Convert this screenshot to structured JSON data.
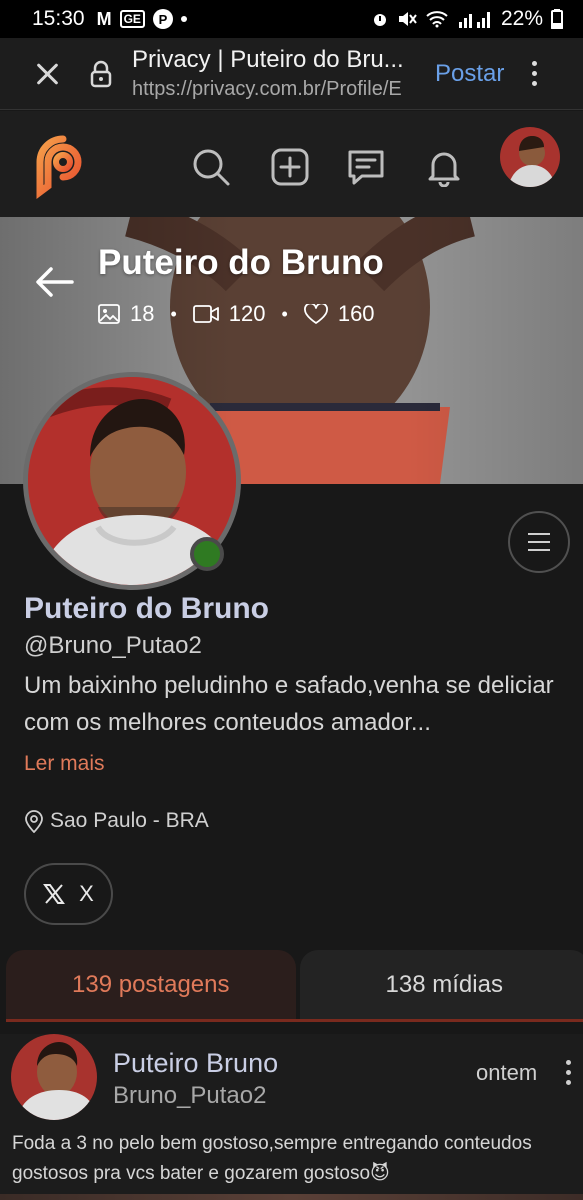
{
  "status_bar": {
    "time": "15:30",
    "battery": "22%",
    "icons": [
      "gmail-icon",
      "news-icon",
      "p-app-icon",
      "dot-icon",
      "alarm-icon",
      "mute-icon",
      "wifi-icon",
      "signal-icon",
      "battery-icon"
    ]
  },
  "browser": {
    "title": "Privacy | Puteiro do Bru...",
    "url": "https://privacy.com.br/Profile/E",
    "action_label": "Postar"
  },
  "header": {
    "icons": [
      "privacy-logo-icon",
      "search-icon",
      "add-post-icon",
      "messages-icon",
      "bell-icon",
      "user-avatar"
    ]
  },
  "cover": {
    "title": "Puteiro do Bruno",
    "photos_count": "18",
    "videos_count": "120",
    "likes_count": "160",
    "separator": "•"
  },
  "profile": {
    "name": "Puteiro do Bruno",
    "handle": "@Bruno_Putao2",
    "bio": "Um baixinho peludinho e safado,venha se deliciar com os melhores conteudos amador...",
    "read_more": "Ler mais",
    "location": "Sao Paulo - BRA",
    "social_label": "X"
  },
  "tabs": [
    {
      "label": "139 postagens",
      "active": true
    },
    {
      "label": "138 mídias",
      "active": false
    }
  ],
  "post": {
    "author": "Puteiro Bruno",
    "username": "Bruno_Putao2",
    "time": "ontem",
    "text": "Foda a 3 no pelo bem gostoso,sempre entregando conteudos gostosos pra vcs bater e gozarem gostoso😈"
  },
  "colors": {
    "accent": "#e07a5a",
    "name_color": "#c9cee4",
    "online": "#2f7a22",
    "link_blue": "#6aa0e8"
  }
}
